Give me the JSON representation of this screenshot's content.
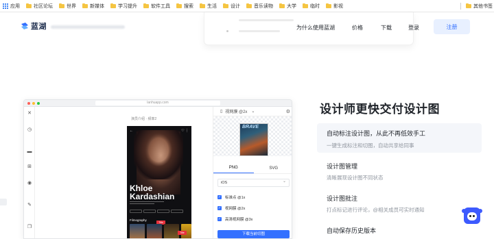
{
  "bookmarks": {
    "apps_label": "应用",
    "items": [
      "社区论坛",
      "世界",
      "新媒体",
      "学习提升",
      "软件工具",
      "搜索",
      "生活",
      "设计",
      "音乐读物",
      "大学",
      "临时",
      "影视"
    ],
    "other_label": "其他书签"
  },
  "nav": {
    "logo_text": "蓝湖",
    "links": [
      "为什么使用蓝湖",
      "价格",
      "下载",
      "登录"
    ],
    "signup_label": "注册"
  },
  "mockup": {
    "url": "lanhuapp.com",
    "breadcrumb": "演员介绍 · 频率2",
    "phone": {
      "title_line1": "Khloe",
      "title_line2": "Kardashian",
      "filmography_label": "Filmography",
      "tag1": "Title",
      "tag2": "Title"
    },
    "panel": {
      "header_label": "视网膜 @2x",
      "thumb_title": "BRAVE",
      "tab_png": "PNG",
      "tab_svg": "SVG",
      "os_value": "iOS",
      "checks": [
        "标准点 @1x",
        "视网膜 @2x",
        "高清视网膜 @3x"
      ],
      "download_label": "下载当前切图"
    }
  },
  "features": {
    "title": "设计师更快交付设计图",
    "items": [
      {
        "heading": "自动标注设计图，从此不再低效手工",
        "desc": "一键生成标注和切图，自动共享给同事"
      },
      {
        "heading": "设计图管理",
        "desc": "清晰展现设计图不同状态"
      },
      {
        "heading": "设计图批注",
        "desc": "打点标记进行评论，@相关成员可实时通知"
      },
      {
        "heading": "自动保存历史版本",
        "desc": ""
      }
    ]
  },
  "colors": {
    "accent": "#3370ff",
    "signup_bg": "#e8f0ff",
    "bot": "#3d5afe"
  }
}
